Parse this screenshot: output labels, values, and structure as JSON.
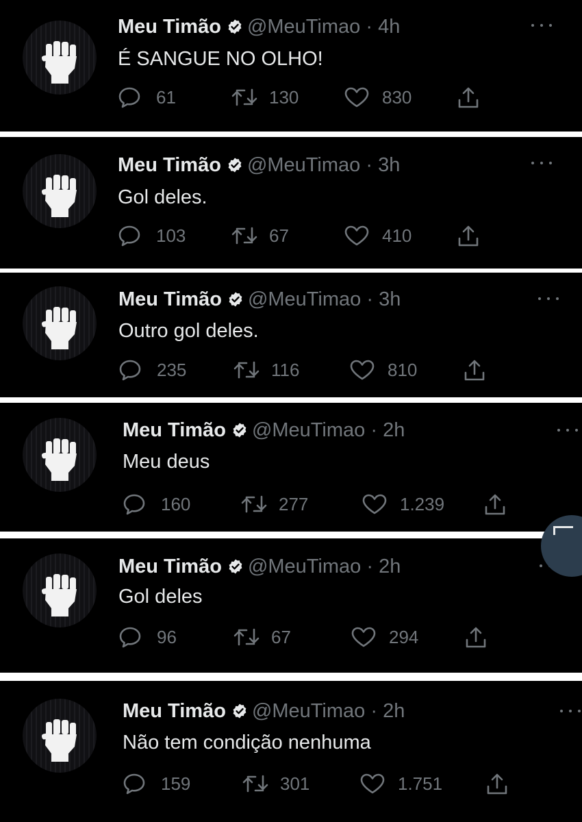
{
  "account": {
    "name": "Meu Timão",
    "handle": "@MeuTimao",
    "separator": "·"
  },
  "colors": {
    "background": "#000000",
    "text_primary": "#e7e9ea",
    "text_secondary": "#71767b",
    "verified_badge": "#e7e9ea"
  },
  "icons": {
    "reply": "reply-icon",
    "retweet": "retweet-icon",
    "like": "like-icon",
    "share": "share-icon",
    "more": "more-icon",
    "verified": "verified-badge-icon",
    "avatar": "raised-fist-icon"
  },
  "tweets": [
    {
      "time": "4h",
      "text": "É SANGUE NO OLHO!",
      "replies": "61",
      "retweets": "130",
      "likes": "830"
    },
    {
      "time": "3h",
      "text": "Gol deles.",
      "replies": "103",
      "retweets": "67",
      "likes": "410"
    },
    {
      "time": "3h",
      "text": "Outro gol deles.",
      "replies": "235",
      "retweets": "116",
      "likes": "810"
    },
    {
      "time": "2h",
      "text": "Meu deus",
      "replies": "160",
      "retweets": "277",
      "likes": "1.239"
    },
    {
      "time": "2h",
      "text": "Gol deles",
      "replies": "96",
      "retweets": "67",
      "likes": "294"
    },
    {
      "time": "2h",
      "text": "Não tem condição nenhuma",
      "replies": "159",
      "retweets": "301",
      "likes": "1.751"
    }
  ]
}
